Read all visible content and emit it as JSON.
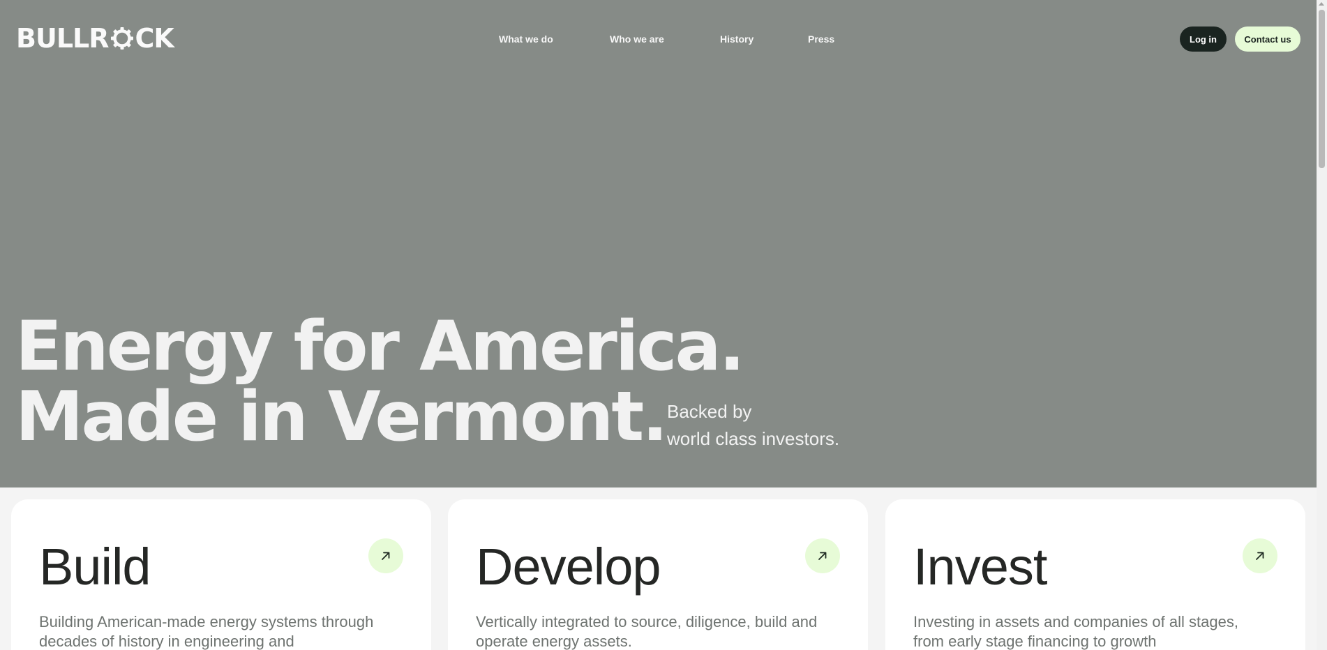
{
  "brand": {
    "logo_text_left": "BULLR",
    "logo_text_right": "CK",
    "logo_icon": "gear-o-icon"
  },
  "nav": {
    "items": [
      {
        "label": "What we do"
      },
      {
        "label": "Who we are"
      },
      {
        "label": "History"
      },
      {
        "label": "Press"
      }
    ]
  },
  "actions": {
    "login_label": "Log in",
    "contact_label": "Contact us"
  },
  "hero": {
    "headline_line1": "Energy for America.",
    "headline_line2": "Made in Vermont.",
    "subline_line1": "Backed by",
    "subline_line2": "world class investors."
  },
  "cards": [
    {
      "title": "Build",
      "description": "Building American-made energy systems through decades of history in engineering and",
      "icon": "arrow-up-right-icon"
    },
    {
      "title": "Develop",
      "description": "Vertically integrated to source, diligence, build and operate energy assets.",
      "icon": "arrow-up-right-icon"
    },
    {
      "title": "Invest",
      "description": "Investing in assets and companies of all stages, from early stage financing to growth",
      "icon": "arrow-up-right-icon"
    }
  ],
  "colors": {
    "hero_bg": "#868b87",
    "accent_mint": "#e7fbd7",
    "dark_button": "#1a2420"
  }
}
